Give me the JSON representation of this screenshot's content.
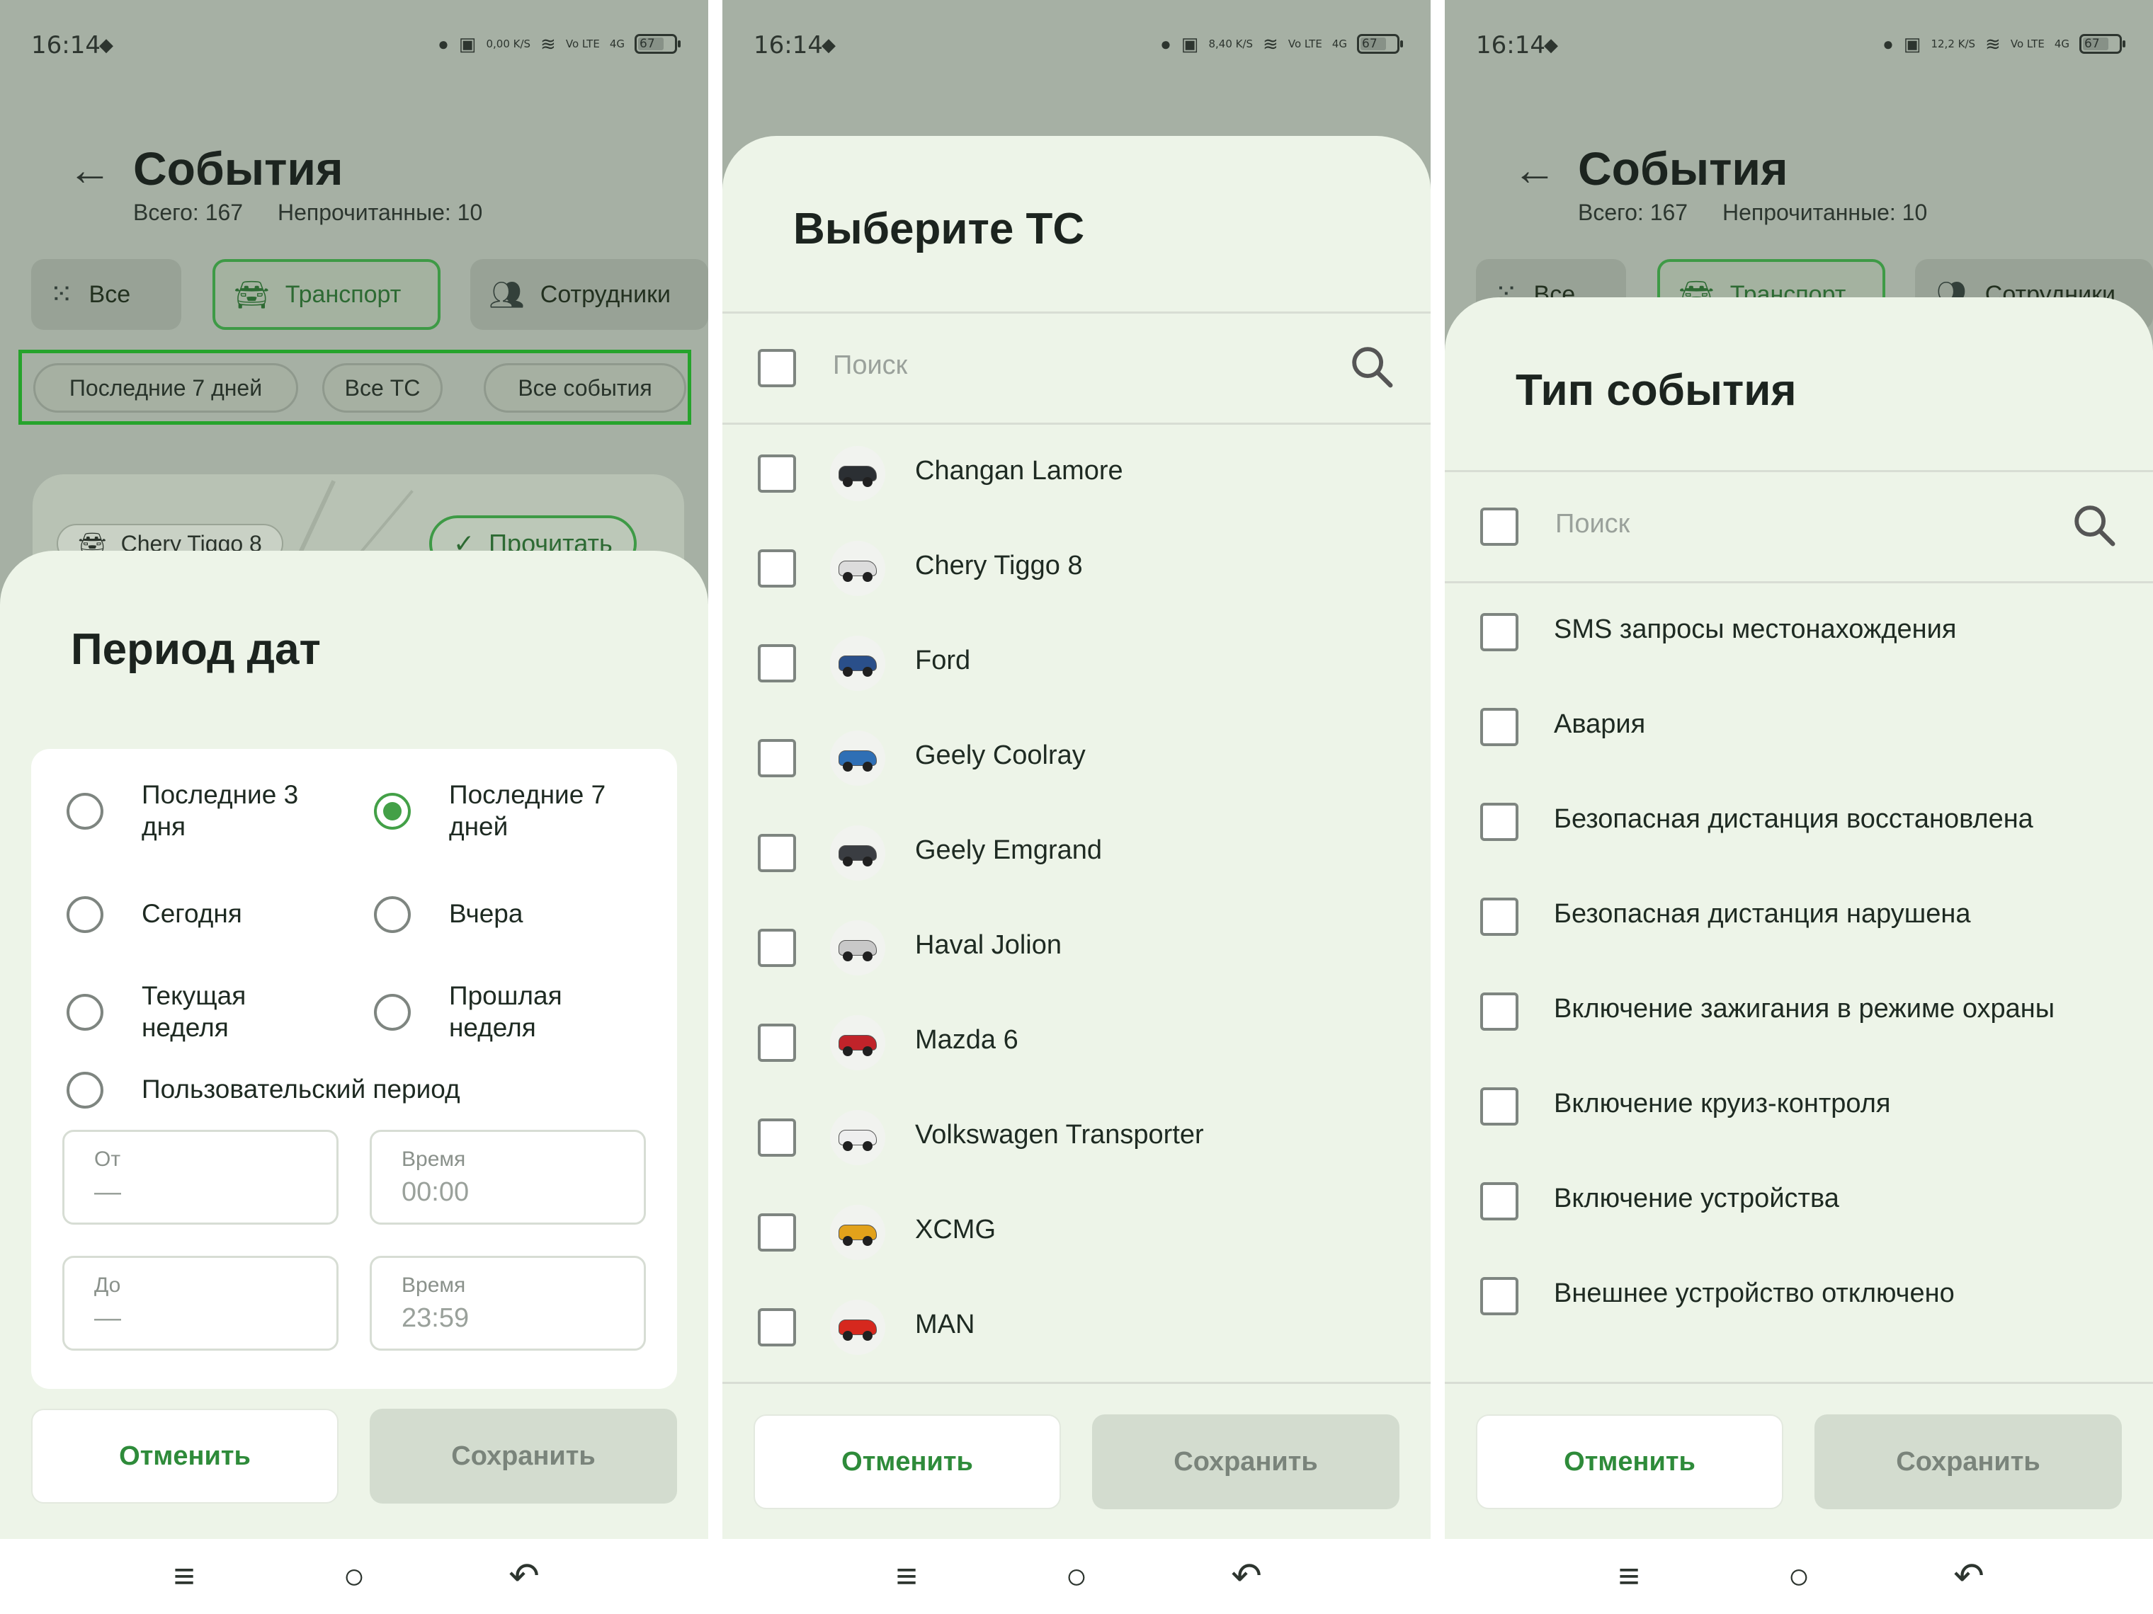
{
  "status": {
    "time": "16:14",
    "speeds": [
      "0,00 K/S",
      "8,40 K/S",
      "12,2 K/S"
    ],
    "network": "Vo LTE",
    "signal": "4G",
    "battery": "67"
  },
  "header": {
    "title": "События",
    "total": "Всего: 167",
    "unread": "Непрочитанные: 10"
  },
  "tabs": [
    {
      "label": "Все"
    },
    {
      "label": "Транспорт"
    },
    {
      "label": "Сотрудники"
    }
  ],
  "filters": [
    "Последние 7 дней",
    "Все ТС",
    "Все события"
  ],
  "event_card": {
    "vehicle": "Chery Tiggo 8",
    "read_button": "Прочитать"
  },
  "date_sheet": {
    "title": "Период дат",
    "options": [
      {
        "label": "Последние 3 дня",
        "checked": false
      },
      {
        "label": "Последние 7 дней",
        "checked": true
      },
      {
        "label": "Сегодня",
        "checked": false
      },
      {
        "label": "Вчера",
        "checked": false
      },
      {
        "label": "Текущая неделя",
        "checked": false
      },
      {
        "label": "Прошлая неделя",
        "checked": false
      },
      {
        "label": "Пользовательский период",
        "checked": false
      }
    ],
    "fields": {
      "from_label": "От",
      "from_value": "—",
      "time1_label": "Время",
      "time1_value": "00:00",
      "to_label": "До",
      "to_value": "—",
      "time2_label": "Время",
      "time2_value": "23:59"
    }
  },
  "vehicle_sheet": {
    "title": "Выберите ТС",
    "search_placeholder": "Поиск",
    "items": [
      {
        "label": "Changan Lamore",
        "color": "#2b2f33"
      },
      {
        "label": "Chery Tiggo 8",
        "color": "#dcdcdc"
      },
      {
        "label": "Ford",
        "color": "#2a4f8a"
      },
      {
        "label": "Geely Coolray",
        "color": "#2f6fb5"
      },
      {
        "label": "Geely Emgrand",
        "color": "#3a3d42"
      },
      {
        "label": "Haval Jolion",
        "color": "#c8c8c8"
      },
      {
        "label": "Mazda 6",
        "color": "#c0232a"
      },
      {
        "label": "Volkswagen Transporter",
        "color": "#eeeeee"
      },
      {
        "label": "XCMG",
        "color": "#e2a21b"
      },
      {
        "label": "MAN",
        "color": "#d6281e"
      }
    ]
  },
  "event_type_sheet": {
    "title": "Тип события",
    "search_placeholder": "Поиск",
    "items": [
      "SMS запросы местонахождения",
      "Авария",
      "Безопасная дистанция восстановлена",
      "Безопасная дистанция нарушена",
      "Включение зажигания в режиме охраны",
      "Включение круиз-контроля",
      "Включение устройства",
      "Внешнее устройство отключено"
    ]
  },
  "buttons": {
    "cancel": "Отменить",
    "save": "Сохранить"
  },
  "colors": {
    "accent": "#43a047",
    "highlight_border": "#26a32c",
    "sheet_bg": "#edf4e8",
    "overlay_bg": "#a6b0a4"
  }
}
